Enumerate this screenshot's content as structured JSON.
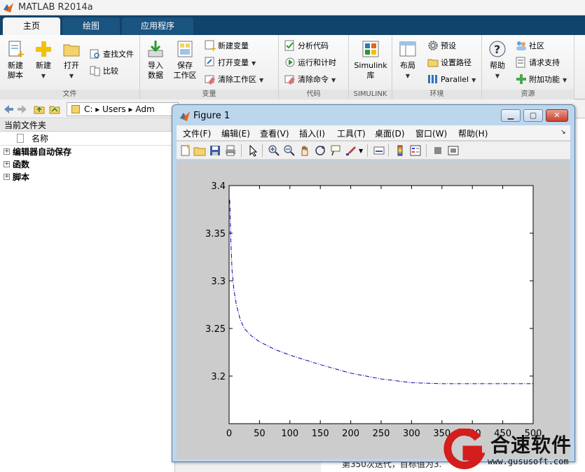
{
  "app": {
    "title": "MATLAB R2014a"
  },
  "tabs": [
    {
      "label": "主页",
      "active": true
    },
    {
      "label": "绘图",
      "active": false
    },
    {
      "label": "应用程序",
      "active": false
    }
  ],
  "ribbon": {
    "file": {
      "group_label": "文件",
      "new_script": "新建\n脚本",
      "new": "新建",
      "open": "打开",
      "find_files": "查找文件",
      "compare": "比较"
    },
    "variable": {
      "group_label": "变量",
      "import": "导入\n数据",
      "save_ws": "保存\n工作区",
      "new_var": "新建变量",
      "open_var": "打开变量",
      "clear_ws": "清除工作区"
    },
    "code": {
      "group_label": "代码",
      "analyze": "分析代码",
      "run_time": "运行和计时",
      "clear_cmd": "清除命令"
    },
    "simulink": {
      "group_label": "SIMULINK",
      "lib": "Simulink\n库"
    },
    "env": {
      "group_label": "环境",
      "layout": "布局",
      "prefs": "预设",
      "set_path": "设置路径",
      "parallel": "Parallel"
    },
    "resources": {
      "group_label": "资源",
      "help": "帮助",
      "community": "社区",
      "support": "请求支持",
      "addons": "附加功能"
    }
  },
  "address": {
    "path": "C: ▸ Users ▸ Adm"
  },
  "folder_panel": {
    "title": "当前文件夹",
    "col_name": "名称",
    "items": [
      "编辑器自动保存",
      "函数",
      "脚本"
    ]
  },
  "command_window": {
    "partial_text": "第350次迭代，目标值为3."
  },
  "figure": {
    "title": "Figure 1",
    "menus": [
      "文件(F)",
      "编辑(E)",
      "查看(V)",
      "插入(I)",
      "工具(T)",
      "桌面(D)",
      "窗口(W)",
      "帮助(H)"
    ],
    "min_label": "▁",
    "max_label": "▢",
    "close_label": "✕"
  },
  "chart_data": {
    "type": "line",
    "x": [
      1,
      3,
      5,
      8,
      12,
      18,
      25,
      35,
      50,
      75,
      100,
      150,
      200,
      250,
      300,
      350,
      400,
      450,
      500
    ],
    "series": [
      {
        "values": [
          3.385,
          3.34,
          3.31,
          3.29,
          3.275,
          3.26,
          3.25,
          3.243,
          3.236,
          3.228,
          3.222,
          3.212,
          3.203,
          3.197,
          3.193,
          3.192,
          3.192,
          3.192,
          3.192
        ],
        "color": "#0000aa",
        "style": "dash-dot"
      }
    ],
    "xlim": [
      0,
      500
    ],
    "ylim": [
      3.15,
      3.4
    ],
    "xticks": [
      "0",
      "50",
      "100",
      "150",
      "200",
      "250",
      "300",
      "350",
      "400",
      "450",
      "500"
    ],
    "yticks": [
      "3.2",
      "3.25",
      "3.3",
      "3.35",
      "3.4"
    ],
    "grid": false
  },
  "watermark": {
    "text": "合速软件",
    "url": "www.gususoft.com"
  }
}
